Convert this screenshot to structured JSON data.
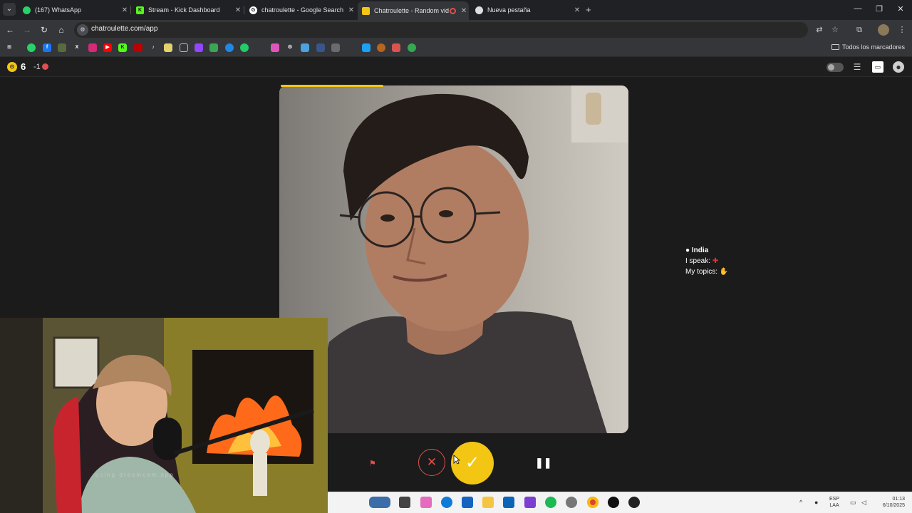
{
  "browser": {
    "tabs": [
      {
        "title": "(167) WhatsApp",
        "favicon": "whatsapp-icon",
        "color": "#25d366"
      },
      {
        "title": "Stream - Kick Dashboard",
        "favicon": "kick-icon",
        "color": "#53fc18"
      },
      {
        "title": "chatroulette - Google Search",
        "favicon": "google-icon",
        "color": "#ffffff"
      },
      {
        "title": "Chatroulette - Random vid",
        "favicon": "chatroulette-icon",
        "color": "#f3c614",
        "active": true
      },
      {
        "title": "Nueva pestaña",
        "favicon": "chrome-icon",
        "color": "#dddddd"
      }
    ],
    "url": "chatroulette.com/app",
    "bookmarks_folder": "Todos los marcadores"
  },
  "app": {
    "coins": "6",
    "delta": "-1",
    "partner": {
      "country": "India",
      "speaks_label": "I speak:",
      "topics_label": "My topics:"
    },
    "accent_color": "#f3c614",
    "danger_color": "#e0504c"
  },
  "overlay": {
    "watermark": "using dreamcam.app"
  },
  "taskbar": {
    "lang_top": "ESP",
    "lang_bottom": "LAA",
    "time": "01:13",
    "date": "6/10/2025"
  }
}
